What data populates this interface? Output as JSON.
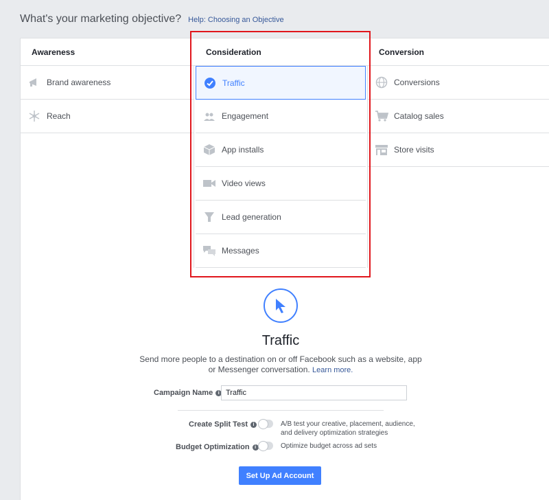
{
  "header": {
    "title": "What's your marketing objective?",
    "help_link": "Help: Choosing an Objective"
  },
  "columns": {
    "awareness": {
      "title": "Awareness",
      "items": [
        {
          "label": "Brand awareness",
          "icon": "megaphone-icon"
        },
        {
          "label": "Reach",
          "icon": "reach-icon"
        }
      ]
    },
    "consideration": {
      "title": "Consideration",
      "items": [
        {
          "label": "Traffic",
          "icon": "check-circle-icon",
          "selected": true
        },
        {
          "label": "Engagement",
          "icon": "people-icon"
        },
        {
          "label": "App installs",
          "icon": "box-icon"
        },
        {
          "label": "Video views",
          "icon": "video-camera-icon"
        },
        {
          "label": "Lead generation",
          "icon": "funnel-icon"
        },
        {
          "label": "Messages",
          "icon": "chat-bubbles-icon"
        }
      ]
    },
    "conversion": {
      "title": "Conversion",
      "items": [
        {
          "label": "Conversions",
          "icon": "globe-icon"
        },
        {
          "label": "Catalog sales",
          "icon": "cart-icon"
        },
        {
          "label": "Store visits",
          "icon": "store-icon"
        }
      ]
    }
  },
  "detail": {
    "icon": "cursor-icon",
    "title": "Traffic",
    "description": "Send more people to a destination on or off Facebook such as a website, app or Messenger conversation.",
    "learn_more": "Learn more."
  },
  "form": {
    "campaign_name_label": "Campaign Name",
    "campaign_name_value": "Traffic",
    "split_test_label": "Create Split Test",
    "split_test_text": "A/B test your creative, placement, audience, and delivery optimization strategies",
    "budget_label": "Budget Optimization",
    "budget_text": "Optimize budget across ad sets",
    "info_glyph": "i",
    "submit_label": "Set Up Ad Account"
  },
  "colors": {
    "accent": "#4080ff",
    "highlight": "#e0151b",
    "icon_gray": "#bec3c9"
  }
}
